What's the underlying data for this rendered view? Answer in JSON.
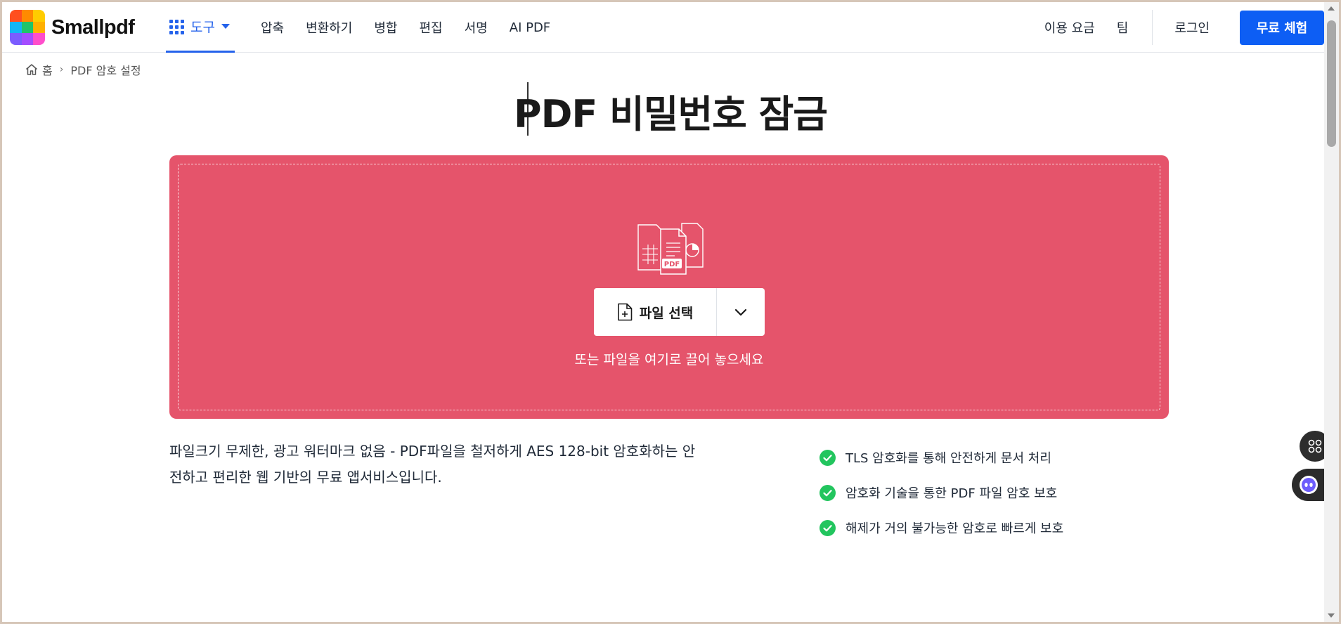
{
  "header": {
    "logo_text": "Smallpdf",
    "tools_label": "도구",
    "nav_items": [
      "압축",
      "변환하기",
      "병합",
      "편집",
      "서명",
      "AI PDF"
    ],
    "pricing_label": "이용 요금",
    "team_label": "팀",
    "login_label": "로그인",
    "cta_label": "무료 체험"
  },
  "breadcrumb": {
    "home_label": "홈",
    "current_label": "PDF 암호 설정"
  },
  "page_title": "PDF 비밀번호 잠금",
  "dropzone": {
    "file_select_label": "파일 선택",
    "drop_hint": "또는 파일을 여기로 끌어 놓으세요",
    "illustration_badge": "PDF"
  },
  "description": {
    "line1": "파일크기 무제한, 광고 워터마크 없음 - PDF파일을 철저하게 AES 128-bit 암호화하는 안",
    "line2": "전하고 편리한 웹 기반의 무료 앱서비스입니다."
  },
  "features": [
    "TLS 암호화를 통해 안전하게 문서 처리",
    "암호화 기술을 통한 PDF 파일 암호 보호",
    "해제가 거의 불가능한 암호로 빠르게 보호"
  ],
  "colors": {
    "brand_blue": "#0d5ef4",
    "dropzone_red": "#e5546b",
    "check_green": "#22c55e"
  },
  "icons": [
    "home-icon",
    "grid-icon",
    "file-add-icon",
    "chevron-down-icon",
    "check-icon",
    "apps-icon",
    "ai-assistant-icon"
  ]
}
